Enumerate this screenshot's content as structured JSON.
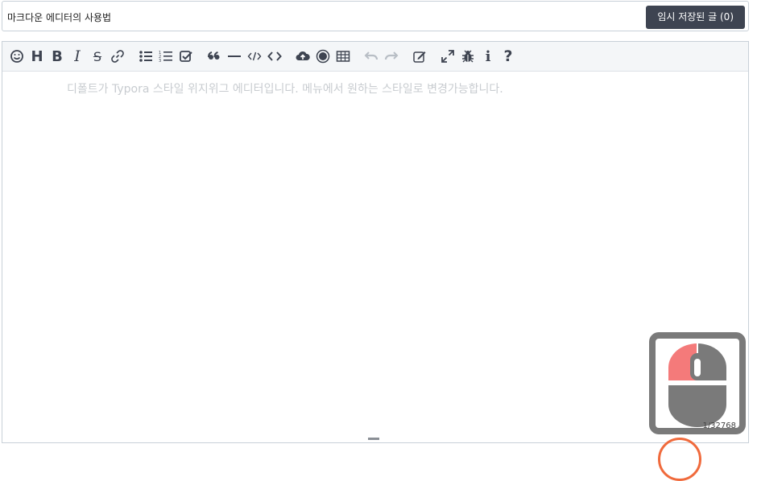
{
  "header": {
    "title_value": "마크다운 에디터의 사용법",
    "draft_button_label": "임시 저장된 글 (0)"
  },
  "toolbar": {
    "items": [
      {
        "name": "emoji-icon"
      },
      {
        "name": "heading-icon",
        "glyph": "H"
      },
      {
        "name": "bold-icon",
        "glyph": "B"
      },
      {
        "name": "italic-icon",
        "glyph": "I"
      },
      {
        "name": "strikethrough-icon",
        "glyph": "S"
      },
      {
        "name": "link-icon"
      },
      {
        "name": "unordered-list-icon"
      },
      {
        "name": "ordered-list-icon"
      },
      {
        "name": "checklist-icon"
      },
      {
        "name": "blockquote-icon"
      },
      {
        "name": "horizontal-rule-icon"
      },
      {
        "name": "inline-code-icon"
      },
      {
        "name": "code-block-icon"
      },
      {
        "name": "upload-icon"
      },
      {
        "name": "record-icon"
      },
      {
        "name": "table-icon"
      },
      {
        "name": "undo-icon",
        "disabled": true
      },
      {
        "name": "redo-icon",
        "disabled": true
      },
      {
        "name": "edit-icon"
      },
      {
        "name": "fullscreen-icon"
      },
      {
        "name": "bug-icon"
      },
      {
        "name": "info-icon",
        "glyph": "i"
      },
      {
        "name": "help-icon",
        "glyph": "?"
      }
    ]
  },
  "editor": {
    "placeholder": "디폴트가 Typora 스타일 위지위그 에디터입니다. 메뉴에서 원하는 스타일로 변경가능합니다."
  },
  "mouse_widget": {
    "counter": "1/32768",
    "left_button_color": "#f47a7a",
    "body_color": "#7a7a7a"
  },
  "colors": {
    "button_bg": "#3e4451",
    "accent_orange": "#f06a3c"
  }
}
